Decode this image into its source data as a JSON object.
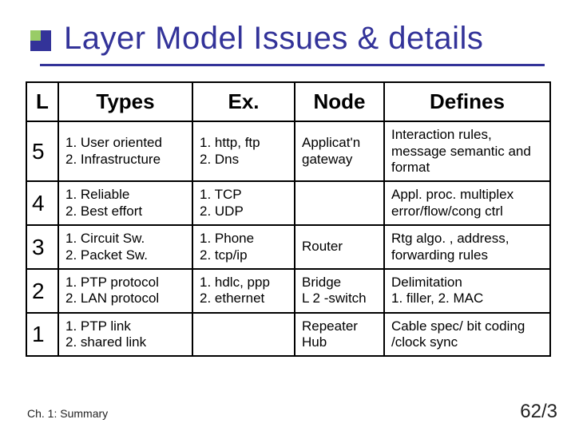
{
  "title": "Layer Model Issues & details",
  "headers": {
    "l": "L",
    "types": "Types",
    "ex": "Ex.",
    "node": "Node",
    "defines": "Defines"
  },
  "rows": [
    {
      "layer": "5",
      "types": "1. User oriented\n2. Infrastructure",
      "ex": "1. http, ftp\n2. Dns",
      "node": "Applicat'n gateway",
      "defines": "Interaction rules, message semantic and format"
    },
    {
      "layer": "4",
      "types": "1. Reliable\n2. Best effort",
      "ex": "1. TCP\n2. UDP",
      "node": "",
      "defines": "Appl. proc. multiplex error/flow/cong ctrl"
    },
    {
      "layer": "3",
      "types": "1. Circuit Sw.\n2. Packet Sw.",
      "ex": "1. Phone\n2. tcp/ip",
      "node": "Router",
      "defines": "Rtg algo. , address, forwarding rules"
    },
    {
      "layer": "2",
      "types": "1. PTP protocol\n2. LAN protocol",
      "ex": "1. hdlc, ppp\n2. ethernet",
      "node": "Bridge\nL 2 -switch",
      "defines": "Delimitation\n1. filler, 2. MAC"
    },
    {
      "layer": "1",
      "types": "1. PTP link\n2. shared link",
      "ex": "",
      "node": "Repeater Hub",
      "defines": "Cable spec/ bit coding /clock sync"
    }
  ],
  "footer": {
    "left": "Ch. 1: Summary",
    "right": "62/3"
  }
}
